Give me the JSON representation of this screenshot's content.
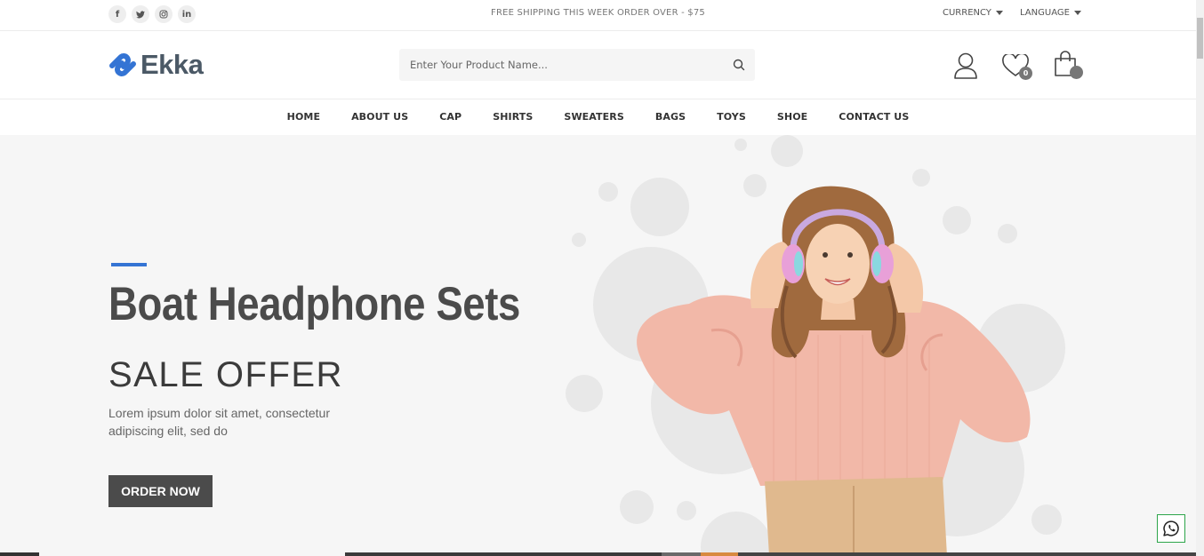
{
  "topbar": {
    "social": [
      "f",
      "𝕥",
      "◎",
      "in"
    ],
    "shipping_text": "FREE SHIPPING THIS WEEK ORDER OVER - $75",
    "currency_label": "CURRENCY",
    "language_label": "LANGUAGE"
  },
  "header": {
    "logo_text": "Ekka",
    "search_placeholder": "Enter Your Product Name...",
    "wishlist_count": "0"
  },
  "nav": {
    "items": [
      "HOME",
      "ABOUT US",
      "CAP",
      "SHIRTS",
      "SWEATERS",
      "BAGS",
      "TOYS",
      "SHOE",
      "CONTACT US"
    ]
  },
  "hero": {
    "title": "Boat Headphone Sets",
    "subtitle": "SALE OFFER",
    "description": "Lorem ipsum dolor sit amet, consectetur adipiscing elit, sed do",
    "button_label": "ORDER NOW"
  },
  "colors": {
    "accent": "#3474d4",
    "dark": "#4b4b4b",
    "hero_bg": "#f6f6f6",
    "whatsapp": "#2da54a"
  }
}
